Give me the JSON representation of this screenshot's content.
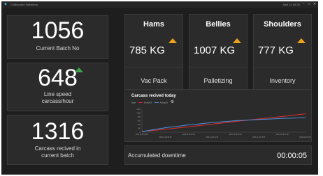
{
  "window": {
    "title": "Cutting and Deboning",
    "datetime": "April 21 08:35",
    "controls": [
      "–",
      "□",
      "✕"
    ]
  },
  "counters": {
    "batch": {
      "value": "1056",
      "label": "Current Batch No"
    },
    "speed": {
      "value": "648",
      "label_line1": "Line speed",
      "label_line2": "carcass/hour",
      "trend": "up",
      "trend_color": "#3da34a"
    },
    "carcass": {
      "value": "1316",
      "label_line1": "Carcass recived in",
      "label_line2": "current batch"
    }
  },
  "products": [
    {
      "name": "Hams",
      "weight": "785 KG",
      "trend": "up",
      "action": "Vac Pack"
    },
    {
      "name": "Bellies",
      "weight": "1007 KG",
      "trend": "up",
      "action": "Palletizing"
    },
    {
      "name": "Shoulders",
      "weight": "777 KG",
      "trend": "up",
      "action": "Inventory"
    }
  ],
  "colors": {
    "trend_up_product": "#f0a21b",
    "background": "#1e1e1e",
    "card": "#2b2b2b"
  },
  "chart_data": {
    "type": "line",
    "title": "Carcass recived today",
    "legend": [
      {
        "label": "Date",
        "color": ""
      },
      {
        "label": "Series A",
        "color": "#e03030"
      },
      {
        "label": "Actual B",
        "color": "#4a90e2"
      }
    ],
    "x": [
      0,
      1,
      2,
      3,
      4,
      5,
      6,
      7
    ],
    "series": [
      {
        "name": "Series A",
        "color": "#e03030",
        "values": [
          40,
          150,
          280,
          420,
          560,
          690,
          820,
          960
        ]
      },
      {
        "name": "Actual B",
        "color": "#4a90e2",
        "values": [
          30,
          230,
          380,
          500,
          600,
          660,
          720,
          760
        ]
      }
    ],
    "ylim": [
      0,
      1200
    ],
    "yticks": [
      "1200",
      "1000",
      "800",
      "600",
      "400",
      "200",
      "0"
    ],
    "xticks": [
      "2016-11-28 08:00",
      "2016-11-28 09:00",
      "2016-11-28 10:00",
      "2016-11-28 11:00",
      "2016-11-28 12:00",
      "2016-11-28 13:00",
      "2016-11-28 14:00",
      "2016-11-28 15:00"
    ],
    "grid": false,
    "legend_position": "top-left"
  },
  "downtime": {
    "label": "Accumulated downtime",
    "value": "00:00:05"
  }
}
